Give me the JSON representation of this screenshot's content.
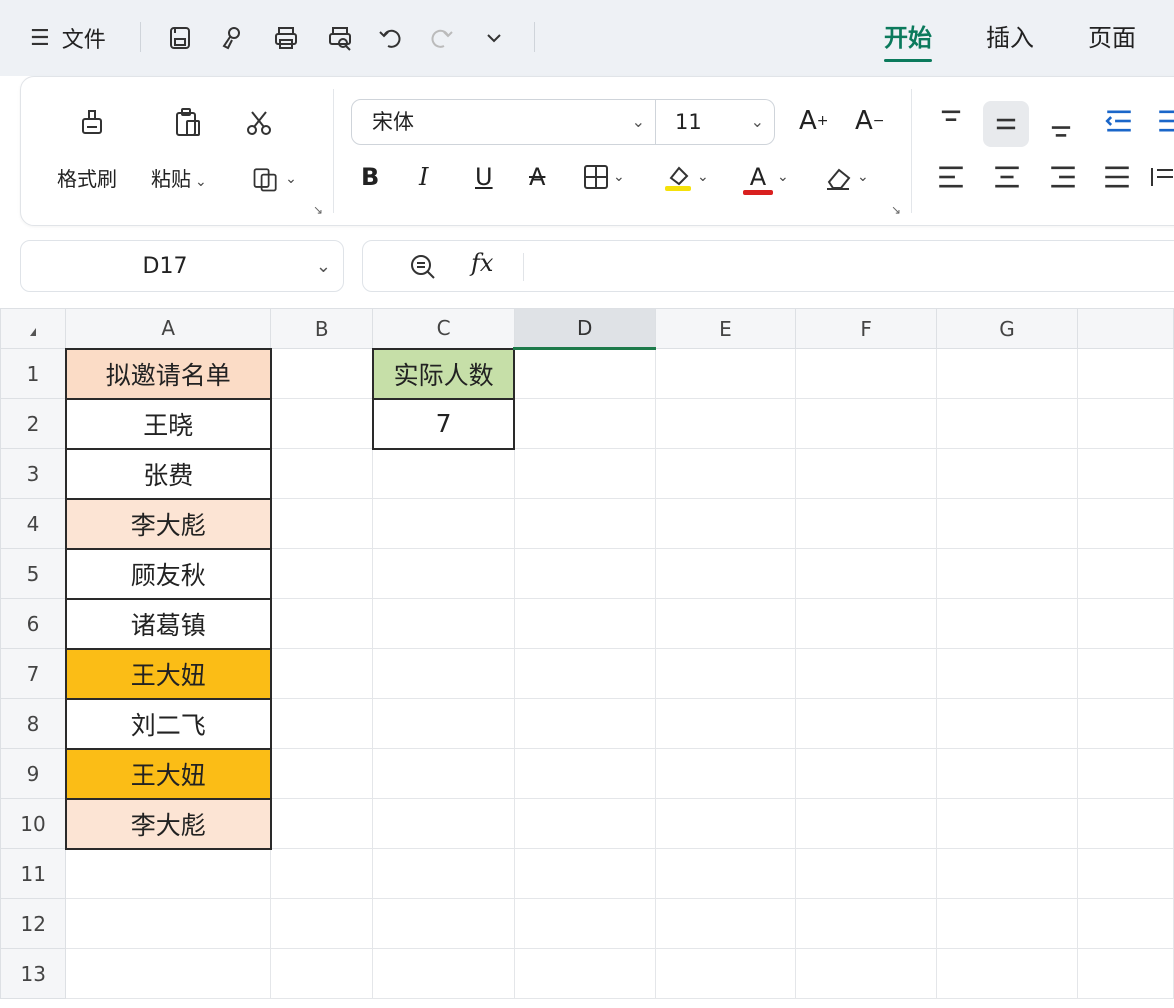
{
  "quick_access": {
    "menu_label": "文件",
    "icons": [
      "menu-icon",
      "save-icon",
      "template-icon",
      "print-icon",
      "print-preview-icon",
      "undo-icon",
      "redo-icon",
      "more-icon"
    ]
  },
  "tabs": [
    {
      "label": "开始",
      "active": true
    },
    {
      "label": "插入",
      "active": false
    },
    {
      "label": "页面",
      "active": false
    }
  ],
  "ribbon": {
    "format_painter_label": "格式刷",
    "paste_label": "粘贴",
    "font_name": "宋体",
    "font_size": "11",
    "bold_glyph": "B",
    "italic_glyph": "I",
    "underline_glyph": "U",
    "strike_glyph": "A",
    "grow_glyph": "A",
    "shrink_glyph": "A",
    "font_color_glyph": "A",
    "highlight_color": "#f5e10a",
    "font_color": "#d9201f"
  },
  "name_box": "D17",
  "formula_bar": {
    "fx_label": "fx",
    "value": ""
  },
  "columns": [
    "A",
    "B",
    "C",
    "D",
    "E",
    "F",
    "G"
  ],
  "selected_column": "D",
  "rows": [
    "1",
    "2",
    "3",
    "4",
    "5",
    "6",
    "7",
    "8",
    "9",
    "10",
    "11",
    "12",
    "13"
  ],
  "col_a": [
    {
      "text": "拟邀请名单",
      "fill": "#fbdcc6"
    },
    {
      "text": "王晓",
      "fill": "#ffffff"
    },
    {
      "text": "张费",
      "fill": "#ffffff"
    },
    {
      "text": "李大彪",
      "fill": "#fce4d4"
    },
    {
      "text": "顾友秋",
      "fill": "#ffffff"
    },
    {
      "text": "诸葛镇",
      "fill": "#ffffff"
    },
    {
      "text": "王大妞",
      "fill": "#fbbd16"
    },
    {
      "text": "刘二飞",
      "fill": "#ffffff"
    },
    {
      "text": "王大妞",
      "fill": "#fbbd16"
    },
    {
      "text": "李大彪",
      "fill": "#fce4d4"
    }
  ],
  "col_c": [
    {
      "text": "实际人数",
      "fill": "#c6dfa8"
    },
    {
      "text": "7",
      "fill": "#ffffff"
    }
  ]
}
